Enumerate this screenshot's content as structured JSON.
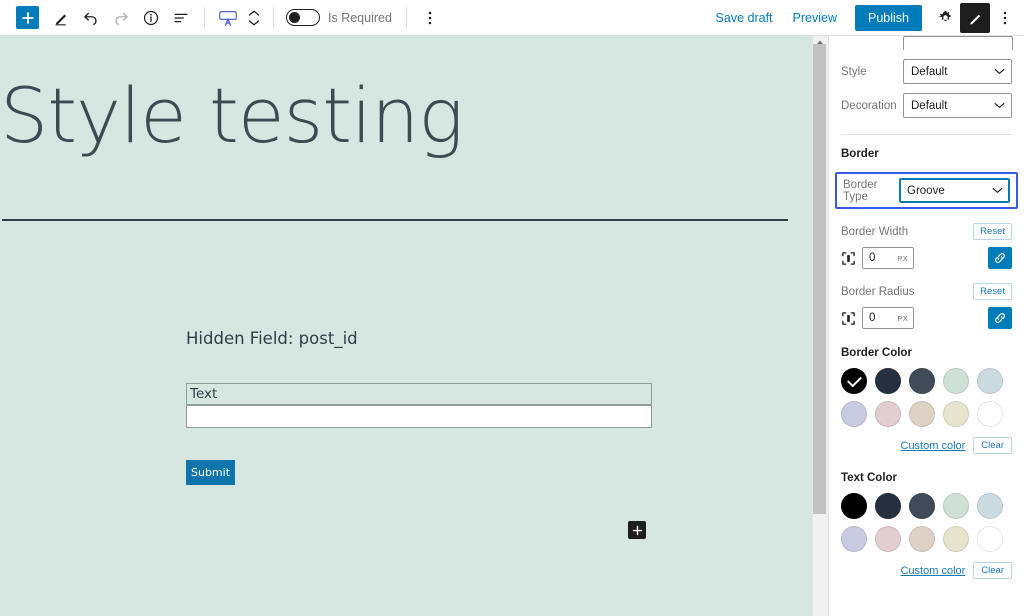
{
  "header": {
    "add_block_label": "+",
    "tools": [
      {
        "name": "edit-tool",
        "label": "Edit"
      },
      {
        "name": "undo",
        "label": "Undo"
      },
      {
        "name": "redo",
        "label": "Redo"
      },
      {
        "name": "details",
        "label": "Details"
      },
      {
        "name": "list-view",
        "label": "List view"
      }
    ],
    "block_type_label": "Input field block",
    "move_up_label": "Move up",
    "move_down_label": "Move down",
    "is_required": {
      "label": "Is Required",
      "enabled": false
    },
    "more_options_label": "Options",
    "save_draft_label": "Save draft",
    "preview_label": "Preview",
    "publish_label": "Publish",
    "settings_label": "Settings",
    "styles_label": "Styles",
    "more_label": "More"
  },
  "canvas": {
    "post_title": "Style testing",
    "hidden_field_label": "Hidden Field: post_id",
    "text_field_label": "Text",
    "text_field_value": "",
    "submit_label": "Submit",
    "appender_label": "+",
    "background_color": "#d6e6e0"
  },
  "sidebar": {
    "style_row": {
      "label": "Style",
      "value": "Default"
    },
    "decoration_row": {
      "label": "Decoration",
      "value": "Default"
    },
    "border_section_title": "Border",
    "border_type": {
      "label": "Border Type",
      "value": "Groove"
    },
    "border_width": {
      "label": "Border Width",
      "reset_label": "Reset",
      "value": "0",
      "unit": "PX",
      "link_label": "Link sides"
    },
    "border_radius": {
      "label": "Border Radius",
      "reset_label": "Reset",
      "value": "0",
      "unit": "PX",
      "link_label": "Link corners"
    },
    "border_color": {
      "title": "Border Color",
      "custom_label": "Custom color",
      "clear_label": "Clear",
      "selected_index": 0,
      "swatches": [
        "#000000",
        "#24303e",
        "#3f4b58",
        "#cfe0d6",
        "#ccdbe2",
        "#c9cbe3",
        "#e1cdd2",
        "#ded2c6",
        "#e6e3ce",
        "#ffffff"
      ]
    },
    "text_color": {
      "title": "Text Color",
      "custom_label": "Custom color",
      "clear_label": "Clear",
      "selected_index": -1,
      "swatches": [
        "#000000",
        "#24303e",
        "#3f4b58",
        "#cfe0d6",
        "#ccdbe2",
        "#c9cbe3",
        "#e1cdd2",
        "#ded2c6",
        "#e6e3ce",
        "#ffffff"
      ]
    },
    "accent_color": "#007cba",
    "focus_outline_color": "#3858e9"
  }
}
